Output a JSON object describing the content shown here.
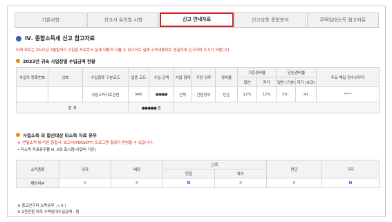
{
  "tabs": [
    {
      "label": "기본사항",
      "active": false
    },
    {
      "label": "신고시 유의할 사항",
      "active": false
    },
    {
      "label": "신고 안내자료",
      "active": true
    },
    {
      "label": "신고상항 종합분석",
      "active": false
    },
    {
      "label": "주택임대소득 참고자료",
      "active": false
    }
  ],
  "section_title": "Ⅳ. 종합소득세 신고 참고자료",
  "notice": "이래 자료는 2022년 3월말까지 수집된 자료로서 실제 내용과 다를 수 있으므로 실제 소득내용대로 성실하게 신고하여 주시기 바랍니다.",
  "income_section": {
    "title": "2022년 귀속 사업장별 수입금액 현황",
    "headers": {
      "biz_reg_no": "사업자 등록번호",
      "trade_name": "상호",
      "income_type": "수입종류 구분코드",
      "industry_code": "업종 코드",
      "income_amount": "수입 금액",
      "biz_type": "사업 형태",
      "bookkeeping": "기장 의무",
      "expense_rate": "경비율",
      "basic_rate": "기준경비율",
      "simple_rate": "단순경비율",
      "general": "일반",
      "self": "자가",
      "simple_general": "일반 (기본)",
      "simple_self": "자가 (초과)",
      "main_purchase": "주요 매입 정수의무자"
    },
    "row": {
      "biz_reg_no": "",
      "trade_name": "",
      "income_type": "사업소득자료관련",
      "industry_code": "940",
      "income_amount": "●●●●",
      "biz_type": "단독",
      "bookkeeping": "간편장부",
      "expense_rate": "단순",
      "general": "12%",
      "self": "12%",
      "simple_general": "50..",
      "simple_self": "41",
      "main_purchase": "****"
    },
    "total": {
      "label": "합 계",
      "amount": "●●●●● 원"
    }
  },
  "other_section": {
    "title": "사업소득 외 합산대상 타소득 자료 유무",
    "red_note": "※ '연말소득'에 따른 종합사. 보고서(PERSEFT) 프로그램 결과가 반영될 수 있습니다.",
    "black_note": "• 타소득 자료유무를 O, X로 표시함(사업비 기준)",
    "headers": {
      "income_type": "소득종류",
      "interest": "이자",
      "dividend": "배당",
      "labor": "근로",
      "single": "단일",
      "multiple": "복수",
      "pension": "연금",
      "other": "기타"
    },
    "row": {
      "label": "해당여부",
      "interest": "X",
      "dividend": "X",
      "single": "O",
      "multiple": "X",
      "pension": "X",
      "other": "O"
    }
  },
  "footnotes": [
    "※ 종교인기타 소득유무 : ( X )",
    "※ 2천만원 이하 수택임대수입금액 : 원"
  ],
  "colors": {
    "accent_red": "#d42a1e",
    "active_tab_border": "#d0211c",
    "zero_blue": "#1a3fc1",
    "section_icon": "#3a5fb5",
    "bullet": "#e88a1a"
  }
}
